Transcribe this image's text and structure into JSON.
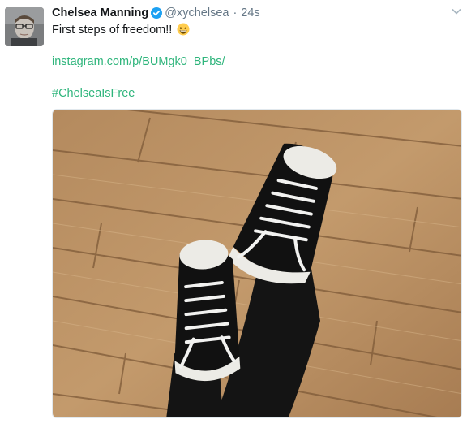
{
  "tweet": {
    "author_name": "Chelsea Manning",
    "handle": "@xychelsea",
    "separator": "·",
    "time": "24s",
    "verified": true,
    "text_line1": "First steps of freedom!!",
    "emoji": "grinning-face-emoji",
    "link": "instagram.com/p/BUMgk0_BPbs/",
    "hashtag": "#ChelseaIsFree"
  },
  "icons": {
    "verified": "verified-badge-icon",
    "caret": "chevron-down-icon"
  },
  "colors": {
    "link": "#2fb57c",
    "verified": "#1da1f2",
    "muted": "#657786"
  }
}
